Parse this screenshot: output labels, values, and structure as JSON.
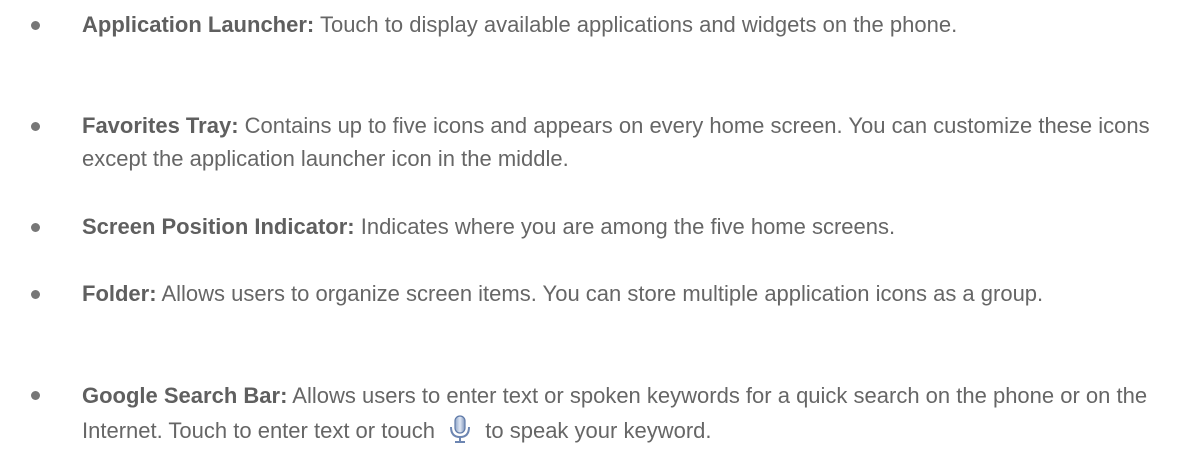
{
  "items": [
    {
      "term": "Application Launcher:",
      "desc": " Touch to display available applications and widgets on the phone."
    },
    {
      "term": "Favorites Tray:",
      "desc": " Contains up to five icons and appears on every home screen. You can customize these icons except the application launcher icon in the middle."
    },
    {
      "term": "Screen Position Indicator:",
      "desc": " Indicates where you are among the five home screens."
    },
    {
      "term": "Folder:",
      "desc": " Allows users to organize screen items. You can store multiple application icons as a group."
    },
    {
      "term": "Google Search Bar:",
      "desc_before": " Allows users to enter text or spoken keywords for a quick search on the phone or on the Internet. Touch to enter text or touch ",
      "icon": "microphone-icon",
      "desc_after": " to speak your keyword."
    }
  ]
}
